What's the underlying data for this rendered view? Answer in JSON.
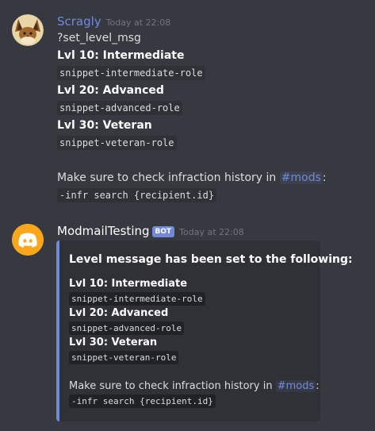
{
  "messages": [
    {
      "username": "Scragly",
      "username_color": "#7289da",
      "timestamp": "Today at 22:08",
      "avatar_icon": "eevee-avatar",
      "lines": {
        "command": "?set_level_msg",
        "lvl10_label": "Lvl 10: Intermediate",
        "lvl10_snippet": "snippet-intermediate-role",
        "lvl20_label": "Lvl 20: Advanced",
        "lvl20_snippet": "snippet-advanced-role",
        "lvl30_label": "Lvl 30: Veteran",
        "lvl30_snippet": "snippet-veteran-role",
        "note_text": "Make sure to check infraction history in ",
        "note_channel": "#mods",
        "note_colon": ":",
        "infr_command": "-infr search {recipient.id}"
      }
    },
    {
      "username": "ModmailTesting",
      "username_color": "#ffffff",
      "bot_tag": "BOT",
      "timestamp": "Today at 22:08",
      "avatar_icon": "discord-logo-avatar",
      "embed": {
        "accent_color": "#7289da",
        "title": "Level message has been set to the following:",
        "lvl10_label": "Lvl 10: Intermediate",
        "lvl10_snippet": "snippet-intermediate-role",
        "lvl20_label": "Lvl 20: Advanced",
        "lvl20_snippet": "snippet-advanced-role",
        "lvl30_label": "Lvl 30: Veteran",
        "lvl30_snippet": "snippet-veteran-role",
        "note_text": "Make sure to check infraction history in ",
        "note_channel": "#mods",
        "note_colon": ":",
        "infr_command": "-infr search {recipient.id}"
      }
    }
  ]
}
